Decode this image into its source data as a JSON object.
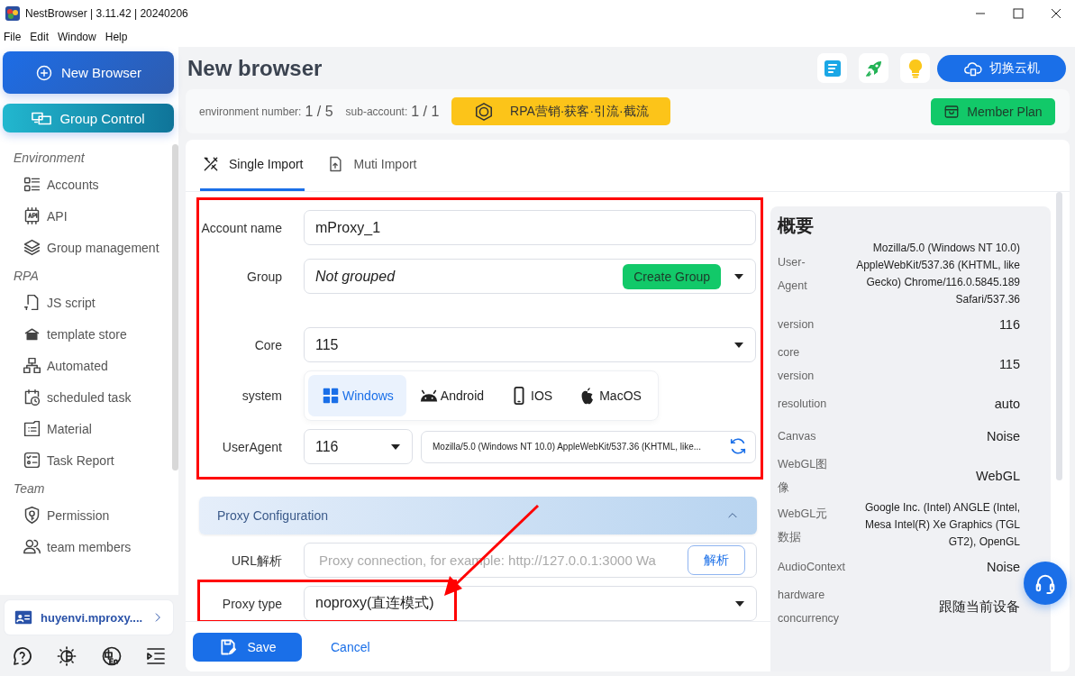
{
  "window": {
    "title": "NestBrowser | 3.11.42 | 20240206"
  },
  "menu": [
    "File",
    "Edit",
    "Window",
    "Help"
  ],
  "sidebar": {
    "new_button": "New Browser",
    "group_button": "Group Control",
    "sections": [
      {
        "title": "Environment",
        "items": [
          "Accounts",
          "API",
          "Group management"
        ]
      },
      {
        "title": "RPA",
        "items": [
          "JS script",
          "template store",
          "Automated",
          "scheduled task",
          "Material",
          "Task Report"
        ]
      },
      {
        "title": "Team",
        "items": [
          "Permission",
          "team members"
        ]
      }
    ],
    "account": "huyenvi.mproxy...."
  },
  "header": {
    "title": "New browser",
    "cloud_button": "切换云机"
  },
  "info_bar": {
    "env_label": "environment number:",
    "env_value": "1 / 5",
    "sub_label": "sub-account:",
    "sub_value": "1 / 1",
    "rpa_button": "RPA营销·获客·引流·截流",
    "member_button": "Member Plan"
  },
  "tabs": [
    {
      "label": "Single Import",
      "selected": true
    },
    {
      "label": "Muti Import",
      "selected": false
    }
  ],
  "form": {
    "account_name": {
      "label": "Account name",
      "value": "mProxy_1"
    },
    "group": {
      "label": "Group",
      "value": "Not grouped",
      "button": "Create Group"
    },
    "core": {
      "label": "Core",
      "value": "115"
    },
    "system": {
      "label": "system",
      "options": [
        {
          "label": "Windows",
          "selected": true
        },
        {
          "label": "Android",
          "selected": false
        },
        {
          "label": "IOS",
          "selected": false
        },
        {
          "label": "MacOS",
          "selected": false
        }
      ]
    },
    "user_agent": {
      "label": "UserAgent",
      "version": "116",
      "value": "Mozilla/5.0 (Windows NT 10.0) AppleWebKit/537.36 (KHTML, like..."
    }
  },
  "proxy": {
    "title": "Proxy Configuration",
    "expanded": true,
    "url": {
      "label": "URL解析",
      "placeholder": "Proxy connection, for example: http://127.0.0.1:3000 Wa",
      "button": "解析"
    },
    "type": {
      "label": "Proxy type",
      "value": "noproxy(直连模式)"
    }
  },
  "summary": {
    "title": "概要",
    "rows": [
      {
        "label": "User-Agent",
        "value": "Mozilla/5.0 (Windows NT 10.0) AppleWebKit/537.36 (KHTML, like Gecko) Chrome/116.0.5845.189 Safari/537.36"
      },
      {
        "label": "version",
        "value": "116"
      },
      {
        "label": "core version",
        "value": "115"
      },
      {
        "label": "resolution",
        "value": "auto"
      },
      {
        "label": "Canvas",
        "value": "Noise"
      },
      {
        "label": "WebGL图像",
        "value": "WebGL"
      },
      {
        "label": "WebGL元数据",
        "value": "Google Inc. (Intel) ANGLE (Intel, Mesa Intel(R) Xe Graphics (TGL GT2), OpenGL"
      },
      {
        "label": "AudioContext",
        "value": "Noise"
      },
      {
        "label": "hardware concurrency",
        "value": "跟随当前设备"
      }
    ]
  },
  "footer": {
    "save": "Save",
    "cancel": "Cancel"
  },
  "annotations": {
    "basic_box": true,
    "proxy_type_box": true,
    "arrow": true
  }
}
